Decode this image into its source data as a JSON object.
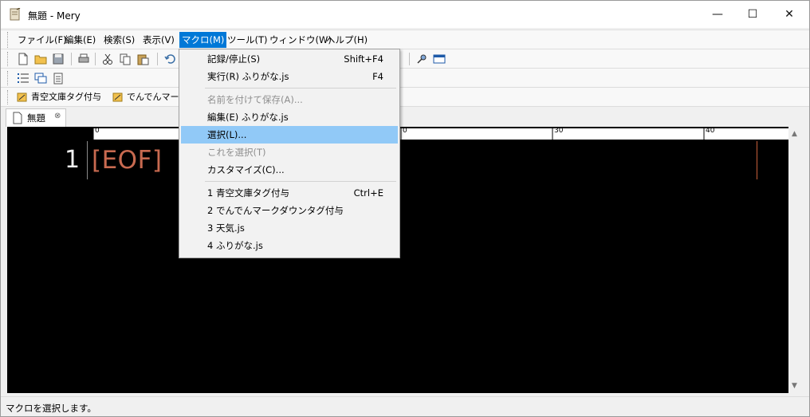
{
  "window": {
    "title": "無題 - Mery",
    "minimize": "—",
    "maximize": "☐",
    "close": "✕"
  },
  "menubar": [
    {
      "label": "ファイル(F)"
    },
    {
      "label": "編集(E)"
    },
    {
      "label": "検索(S)"
    },
    {
      "label": "表示(V)"
    },
    {
      "label": "マクロ(M)",
      "active": true
    },
    {
      "label": "ツール(T)"
    },
    {
      "label": "ウィンドウ(W)"
    },
    {
      "label": "ヘルプ(H)"
    }
  ],
  "favorites": [
    {
      "label": "青空文庫タグ付与"
    },
    {
      "label": "でんでんマーク"
    }
  ],
  "tab": {
    "label": "無題",
    "close": "⊗"
  },
  "editor": {
    "line_number": "1",
    "eof": "[EOF]",
    "ruler_marks": [
      "0",
      "0",
      "30",
      "40"
    ]
  },
  "macro_menu": {
    "items": [
      {
        "label": "記録/停止(S)",
        "shortcut": "Shift+F4"
      },
      {
        "label": "実行(R) ふりがな.js",
        "shortcut": "F4"
      },
      {
        "label": "名前を付けて保存(A)...",
        "shortcut": "",
        "disabled": true
      },
      {
        "label": "編集(E) ふりがな.js",
        "shortcut": ""
      },
      {
        "label": "選択(L)...",
        "shortcut": "",
        "highlighted": true
      },
      {
        "label": "これを選択(T)",
        "shortcut": "",
        "disabled": true
      },
      {
        "label": "カスタマイズ(C)...",
        "shortcut": ""
      },
      {
        "label": "1 青空文庫タグ付与",
        "shortcut": "Ctrl+E"
      },
      {
        "label": "2 でんでんマークダウンタグ付与",
        "shortcut": ""
      },
      {
        "label": "3 天気.js",
        "shortcut": ""
      },
      {
        "label": "4 ふりがな.js",
        "shortcut": ""
      }
    ]
  },
  "statusbar": {
    "text": "マクロを選択します。"
  },
  "colors": {
    "menu_active": "#0078d7",
    "menu_highlight": "#91c9f7",
    "editor_bg": "#000000",
    "eof": "#c86a50",
    "line_number": "#f0f0f0"
  }
}
